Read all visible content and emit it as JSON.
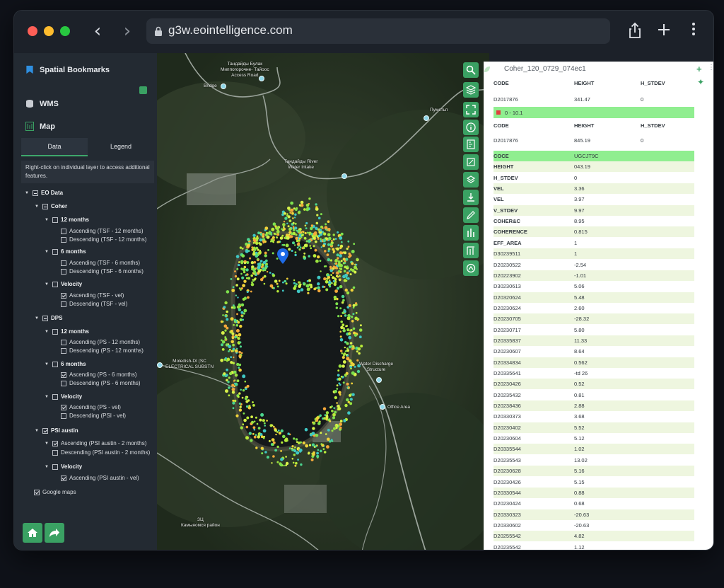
{
  "browser": {
    "url": "g3w.eointelligence.com",
    "back_icon": "chevron-left-icon",
    "forward_icon": "chevron-right-icon",
    "share_icon": "share-icon",
    "new_tab_icon": "plus-icon",
    "menu_icon": "more-vertical-icon"
  },
  "sidebar": {
    "bookmarks_label": "Spatial Bookmarks",
    "wms_label": "WMS",
    "map_label": "Map",
    "tabs": [
      {
        "label": "Data"
      },
      {
        "label": "Legend"
      }
    ],
    "hint": "Right-click on individual layer to access additional features.",
    "tree": {
      "eo_data": "EO Data",
      "coher": "Coher",
      "coher_12": "12 months",
      "coher_12_asc": "Ascending (TSF - 12 months)",
      "coher_12_desc": "Descending (TSF - 12 months)",
      "coher_6": "6 months",
      "coher_6_asc": "Ascending (TSF - 6 months)",
      "coher_6_desc": "Descending (TSF - 6 months)",
      "coher_vel": "Velocity",
      "coher_vel_asc": "Ascending (TSF - vel)",
      "coher_vel_desc": "Descending (TSF - vel)",
      "dps": "DPS",
      "dps_12": "12 months",
      "dps_12_asc": "Ascending (PS - 12 months)",
      "dps_12_desc": "Descending (PS - 12 months)",
      "dps_6": "6 months",
      "dps_6_asc": "Ascending (PS - 6 months)",
      "dps_6_desc": "Descending (PS - 6 months)",
      "dps_vel": "Velocity",
      "dps_vel_asc": "Ascending (PS - vel)",
      "dps_vel_desc": "Descending (PSI - vel)",
      "psi": "PSI austin",
      "psi_asc": "Ascending (PSI austin - 2 months)",
      "psi_desc": "Descending (PSI austin - 2 months)",
      "psi_vel": "Velocity",
      "psi_vel_asc": "Ascending (PSI austin - vel)",
      "google_maps": "Google maps"
    }
  },
  "map": {
    "labels": {
      "top": "Тандайды Булак\nМиппогорочне- Тайоос\nAccess Road",
      "bridge": "Bridge",
      "right_top": "Пумстьп",
      "river": "Тандайды River\nWater Intake",
      "discharge": "Water Discharge\nStructure",
      "office": "Office Area",
      "left": "Moledish-DI (SC\nELECTRICAL SUBSTN",
      "bottom": "ЗЦ\nКамыяомся район"
    }
  },
  "panel": {
    "title": "Coher_120_0729_074ec1",
    "header1": {
      "code": "CODE",
      "height": "HEIGHT",
      "hstdev": "H_STDEV"
    },
    "first_row": {
      "code": "D2017876",
      "height": "341.47",
      "hstdev": "0"
    },
    "range_label": "0 - 10.1",
    "header2": {
      "code": "CODE",
      "height": "HEIGHT",
      "hstdev": "H_STDEV"
    },
    "second_row": {
      "code": "D2017876",
      "height": "845.19",
      "hstdev": "0"
    },
    "attributes": [
      {
        "k": "COCE",
        "v": "UGCJT9C"
      },
      {
        "k": "HEIGHT",
        "v": "043.19"
      },
      {
        "k": "H_STDEV",
        "v": "0"
      },
      {
        "k": "VEL",
        "v": "3.36"
      },
      {
        "k": "VEL",
        "v": "3.97"
      },
      {
        "k": "V_STDEV",
        "v": "9.97"
      },
      {
        "k": "COHER&C",
        "v": "8.95"
      },
      {
        "k": "COHERENCE",
        "v": "0.815"
      },
      {
        "k": "EFF_AREA",
        "v": "1"
      },
      {
        "k": "D30239511",
        "v": "1"
      },
      {
        "k": "D20230522",
        "v": "-2.54"
      },
      {
        "k": "D20223902",
        "v": "-1.01"
      },
      {
        "k": "D30230613",
        "v": "5.06"
      },
      {
        "k": "D20320624",
        "v": "5.48"
      },
      {
        "k": "D20230624",
        "v": "2.60"
      },
      {
        "k": "D20230705",
        "v": "-28.32"
      },
      {
        "k": "D20230717",
        "v": "5.80"
      },
      {
        "k": "D20335837",
        "v": "11.33"
      },
      {
        "k": "D20230607",
        "v": "8.64"
      },
      {
        "k": "D20334834",
        "v": "0.562"
      },
      {
        "k": "D20335641",
        "v": "-td 26"
      },
      {
        "k": "D20230426",
        "v": "0.52"
      },
      {
        "k": "D20235432",
        "v": "0.81"
      },
      {
        "k": "D20238436",
        "v": "2.88"
      },
      {
        "k": "D20330373",
        "v": "3.68"
      },
      {
        "k": "D20230402",
        "v": "5.52"
      },
      {
        "k": "D20230604",
        "v": "5.12"
      },
      {
        "k": "D20335544",
        "v": "1.02"
      },
      {
        "k": "D20235543",
        "v": "13.02"
      },
      {
        "k": "D20230628",
        "v": "5.16"
      },
      {
        "k": "D20230426",
        "v": "5.15"
      },
      {
        "k": "D20330544",
        "v": "0.88"
      },
      {
        "k": "D20230424",
        "v": "0.68"
      },
      {
        "k": "D20330323",
        "v": "-20.63"
      },
      {
        "k": "D20330602",
        "v": "-20.63"
      },
      {
        "k": "D20255542",
        "v": "4.82"
      },
      {
        "k": "D20235542",
        "v": "1.12"
      }
    ]
  },
  "colors": {
    "accent": "#3aa163",
    "highlight": "#90ee90",
    "row_alt": "#eef6df"
  }
}
